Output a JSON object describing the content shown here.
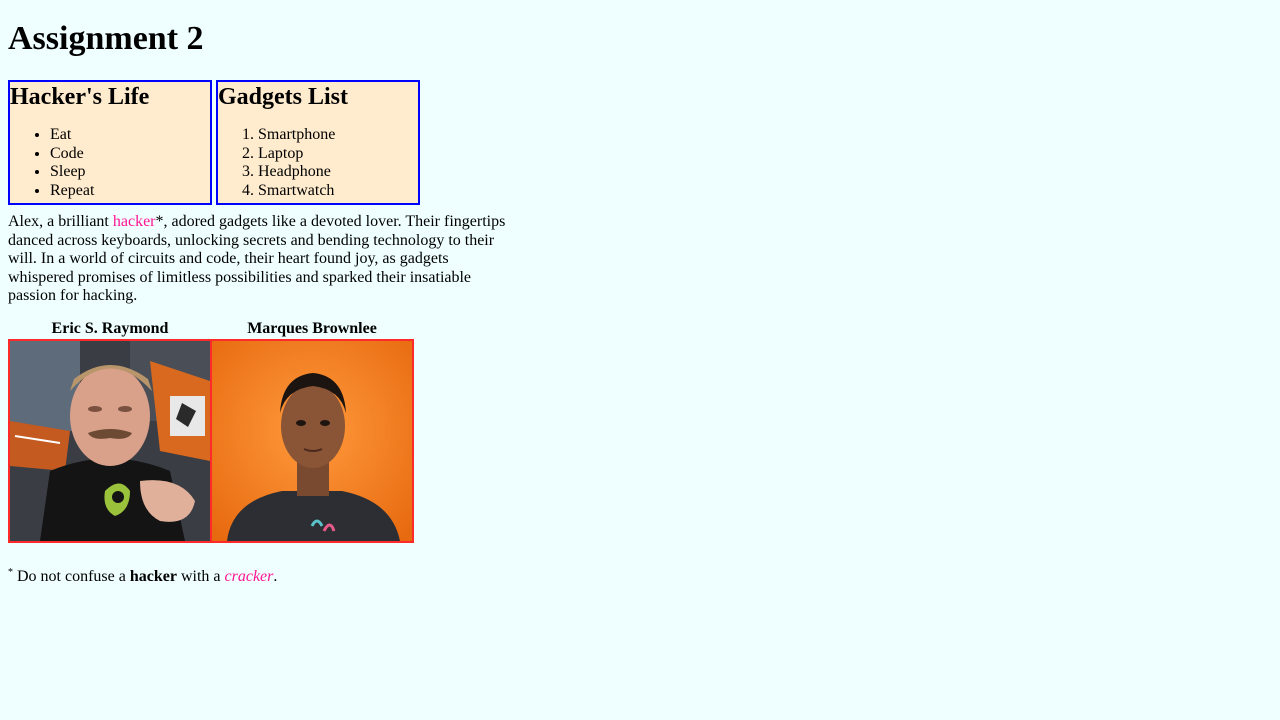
{
  "title": "Assignment 2",
  "hackers_life": {
    "heading": "Hacker's Life",
    "items": [
      "Eat",
      "Code",
      "Sleep",
      "Repeat"
    ]
  },
  "gadgets_list": {
    "heading": "Gadgets List",
    "items": [
      "Smartphone",
      "Laptop",
      "Headphone",
      "Smartwatch"
    ]
  },
  "story": {
    "before": "Alex, a brilliant ",
    "link": "hacker",
    "after": "*, adored gadgets like a devoted lover. Their fingertips danced across keyboards, unlocking secrets and bending technology to their will. In a world of circuits and code, their heart found joy, as gadgets whispered promises of limitless possibilities and sparked their insatiable passion for hacking."
  },
  "figures": [
    {
      "caption": "Eric S. Raymond"
    },
    {
      "caption": "Marques Brownlee"
    }
  ],
  "footnote": {
    "mark": "*",
    "text1": " Do not confuse a ",
    "bold": "hacker",
    "text2": " with a ",
    "italic": "cracker",
    "text3": "."
  },
  "colors": {
    "background": "#efffff",
    "box_fill": "#ffebcd",
    "box_border": "#0000ff",
    "image_border": "#ff2a2a",
    "accent_text": "#ff1493"
  }
}
